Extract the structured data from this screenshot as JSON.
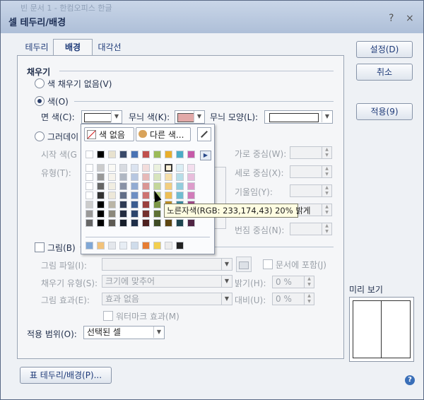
{
  "window": {
    "ghost_title": "빈 문서 1 - 한컴오피스 한글",
    "title": "셀 테두리/배경",
    "help_icon": "?",
    "close_icon": "×"
  },
  "tabs": [
    "테두리",
    "배경",
    "대각선"
  ],
  "buttons": {
    "ok": "설정(D)",
    "cancel": "취소",
    "apply": "적용(9)",
    "table_border": "표 테두리/배경(P)..."
  },
  "fill": {
    "section": "채우기",
    "no_fill": "색 채우기 없음(V)",
    "color": "색(O)",
    "face_color_label": "면 색(C):",
    "pattern_color_label": "무늬 색(K):",
    "pattern_shape_label": "무늬 모양(L):",
    "pattern_color_hex": "#e9ae2b",
    "gradient": "그러데이",
    "start_color_label": "시작 색(G",
    "type_label": "유형(T):",
    "h_center": "가로 중심(W):",
    "v_center": "세로 중심(X):",
    "tilt": "기울임(Y):",
    "spread": "번짐 중심(N):"
  },
  "palette": {
    "no_color": "색 없음",
    "other_colors": "다른 색...",
    "tooltip": "노른자색(RGB: 233,174,43) 20% 밝게",
    "base_colors": [
      "#ffffff",
      "#000000",
      "#e8e2cf",
      "#3a4a6a",
      "#4a73b4",
      "#c0504d",
      "#9bbb59",
      "#e9ae2b",
      "#4bacc6",
      "#c65aa8"
    ],
    "recent_colors": [
      "#7fa7d6",
      "#f2c27a",
      "#e4e7ec",
      "#e7edf4",
      "#cfdceb",
      "#e67d33",
      "#f2cf4f",
      "#ececec",
      "#222222"
    ]
  },
  "picture": {
    "label": "그림(B)",
    "file_label": "그림 파일(I):",
    "fill_type_label": "채우기 유형(S):",
    "fill_type_value": "크기에 맞추어",
    "effect_label": "그림 효과(E):",
    "effect_value": "효과 없음",
    "include_doc": "문서에 포함(J)",
    "brightness_label": "밝기(H):",
    "brightness_value": "0 %",
    "contrast_label": "대비(U):",
    "contrast_value": "0 %",
    "watermark": "워터마크 효과(M)"
  },
  "scope": {
    "label": "적용 범위(O):",
    "value": "선택된 셀"
  },
  "preview": {
    "label": "미리 보기"
  }
}
